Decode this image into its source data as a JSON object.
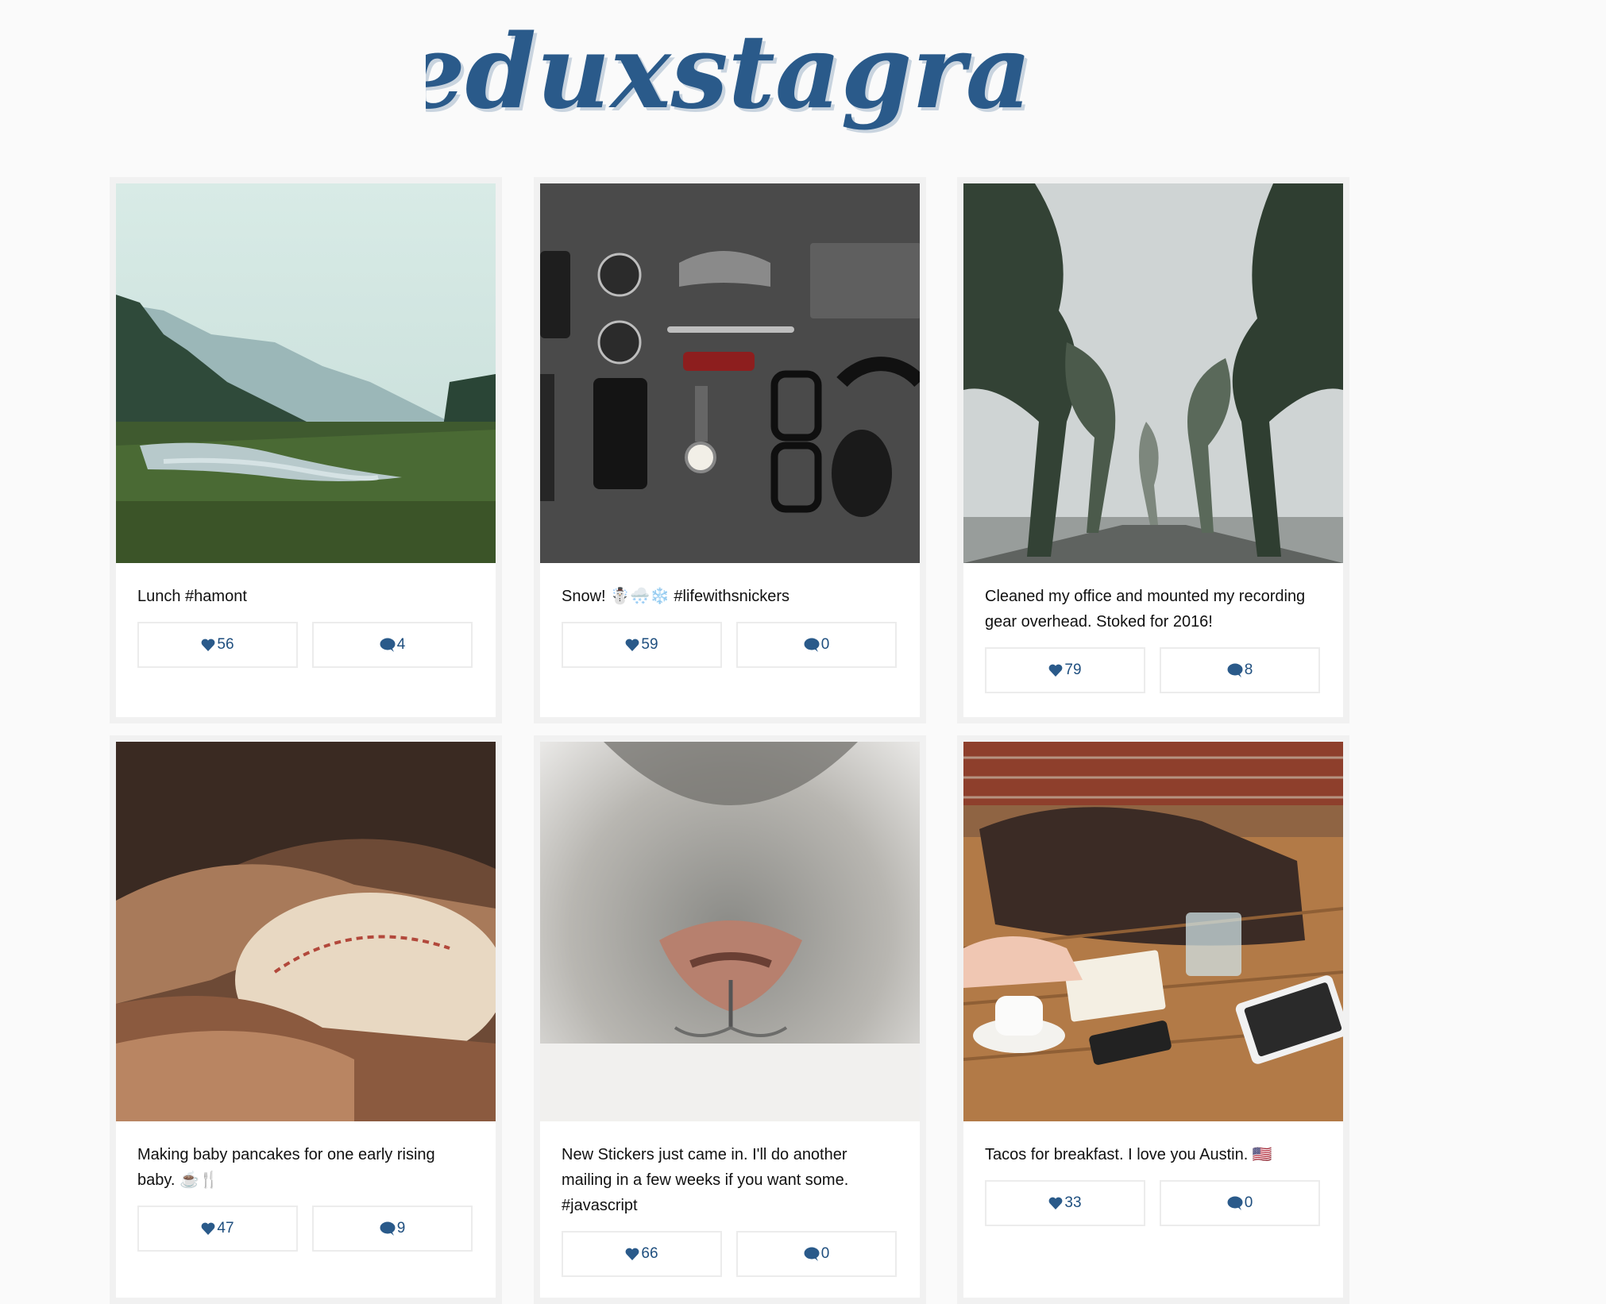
{
  "app": {
    "title": "Reduxstagram",
    "accent": "#2a5a8a"
  },
  "posts": [
    {
      "caption": "Lunch #hamont",
      "likes": "56",
      "comments": "4"
    },
    {
      "caption": "Snow! ☃️🌨️❄️ #lifewithsnickers",
      "likes": "59",
      "comments": "0"
    },
    {
      "caption": "Cleaned my office and mounted my recording gear overhead. Stoked for 2016!",
      "likes": "79",
      "comments": "8"
    },
    {
      "caption": "Making baby pancakes for one early rising baby. ☕️🍴",
      "likes": "47",
      "comments": "9"
    },
    {
      "caption": "New Stickers just came in. I'll do another mailing in a few weeks if you want some. #javascript",
      "likes": "66",
      "comments": "0"
    },
    {
      "caption": "Tacos for breakfast. I love you Austin. 🇺🇸",
      "likes": "33",
      "comments": "0"
    }
  ],
  "icons": {
    "like": "heart-icon",
    "comment": "speech-bubble-icon"
  }
}
